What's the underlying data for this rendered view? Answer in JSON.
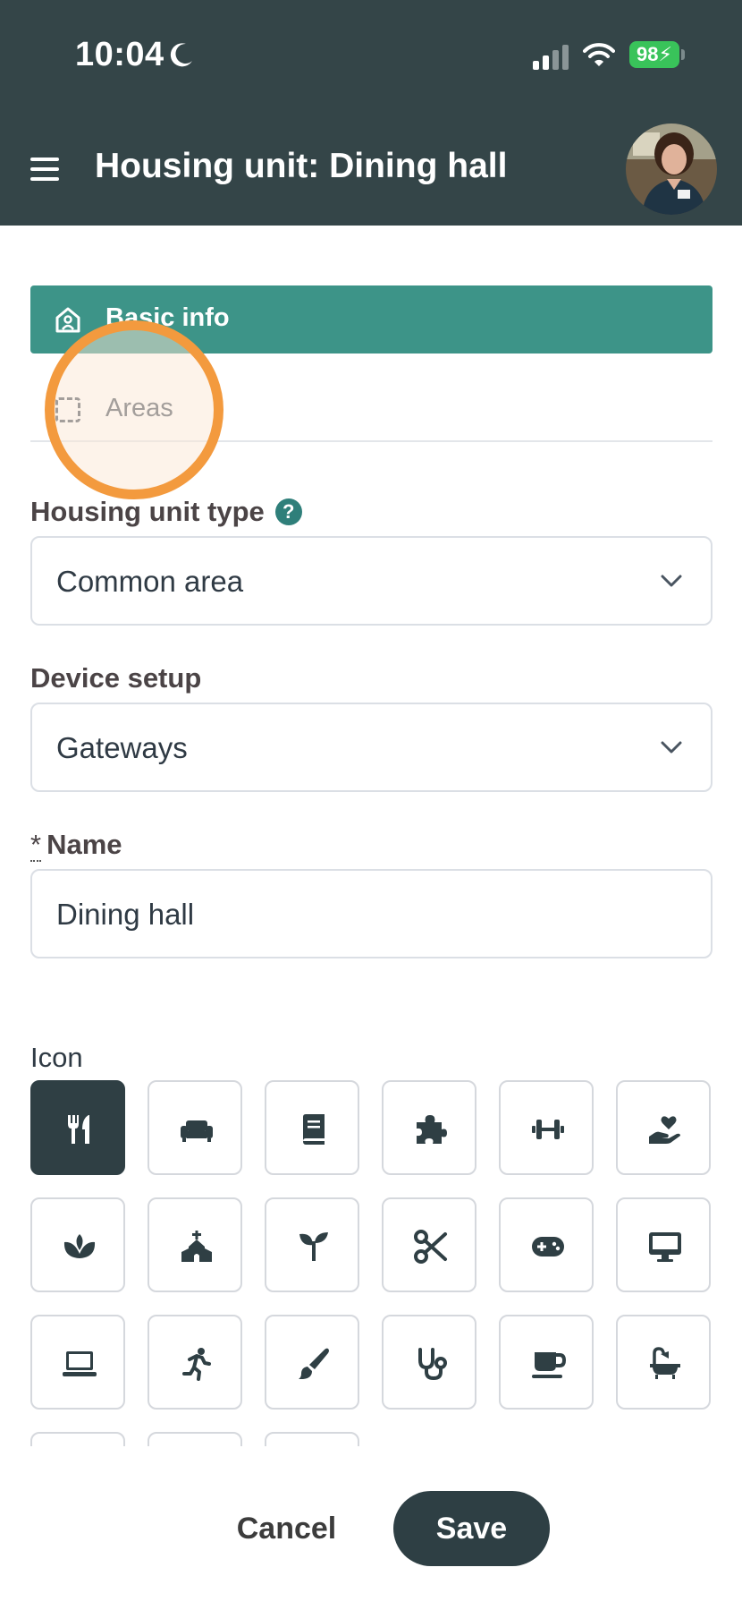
{
  "status_bar": {
    "time": "10:04",
    "battery": "98"
  },
  "app_bar": {
    "title": "Housing unit: Dining hall"
  },
  "tabs": [
    {
      "label": "Basic info",
      "icon": "home-person-icon",
      "active": true
    },
    {
      "label": "Areas",
      "icon": "dashed-square-icon",
      "active": false
    }
  ],
  "form": {
    "housing_unit_type": {
      "label": "Housing unit type",
      "help": "?",
      "value": "Common area"
    },
    "device_setup": {
      "label": "Device setup",
      "value": "Gateways"
    },
    "name": {
      "required_mark": "*",
      "label": "Name",
      "value": "Dining hall"
    },
    "icon": {
      "label": "Icon",
      "options": [
        "utensils",
        "couch",
        "book",
        "puzzle-piece",
        "dumbbell",
        "hand-holding-heart",
        "spa",
        "church",
        "seedling",
        "scissors",
        "gamepad",
        "desktop",
        "laptop",
        "person-running",
        "paintbrush",
        "stethoscope",
        "mug",
        "bath"
      ],
      "selected": "utensils"
    }
  },
  "actions": {
    "cancel": "Cancel",
    "save": "Save"
  },
  "colors": {
    "header": "#344548",
    "tab_active": "#3d9488",
    "save_button": "#2e3f44",
    "touch_indicator": "#f39a3e"
  }
}
